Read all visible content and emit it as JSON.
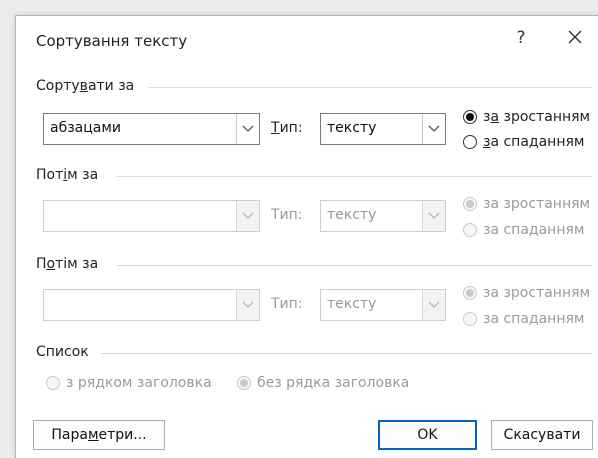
{
  "window": {
    "title": "Сортування тексту",
    "help": "?"
  },
  "sort_by": {
    "label": "Сортувати за",
    "field_value": "абзацами",
    "type_label": "Тип:",
    "type_value": "тексту",
    "asc_label": "за зростанням",
    "desc_label": "за спаданням",
    "asc_checked": true
  },
  "then_by_1": {
    "label": "Потім за",
    "field_value": "",
    "type_label": "Тип:",
    "type_value": "тексту",
    "asc_label": "за зростанням",
    "desc_label": "за спаданням"
  },
  "then_by_2": {
    "label": "Потім за",
    "field_value": "",
    "type_label": "Тип:",
    "type_value": "тексту",
    "asc_label": "за зростанням",
    "desc_label": "за спаданням"
  },
  "list": {
    "label": "Список",
    "with_header": "з рядком заголовка",
    "without_header": "без рядка заголовка"
  },
  "buttons": {
    "options": "Параметри...",
    "ok": "OK",
    "cancel": "Скасувати"
  }
}
